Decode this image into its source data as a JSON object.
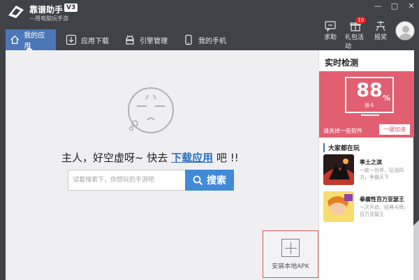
{
  "app": {
    "brand_name": "靠谱助手",
    "version": "V3",
    "tagline": "—用电脑玩手游"
  },
  "window_controls": {
    "minimize": "—",
    "maximize": "□",
    "close": "✕"
  },
  "tabs": [
    {
      "label": "我的应用",
      "icon": "home-icon",
      "active": true
    },
    {
      "label": "应用下载",
      "icon": "download-icon",
      "active": false
    },
    {
      "label": "引擎管理",
      "icon": "android-icon",
      "active": false
    },
    {
      "label": "我的手机",
      "icon": "phone-icon",
      "active": false
    }
  ],
  "actions": [
    {
      "label": "求助",
      "icon": "help-icon"
    },
    {
      "label": "礼包活动",
      "icon": "gift-icon",
      "badge": "10"
    },
    {
      "label": "摇奖",
      "icon": "lottery-icon"
    }
  ],
  "main": {
    "empty_prefix": "主人，好空虚呀~ 快去",
    "empty_link": "下载应用",
    "empty_suffix": "吧 !!",
    "search_placeholder": "试着搜索下，你想玩的手游吧",
    "search_button": "搜索",
    "install_apk": "安装本地APK"
  },
  "monitor": {
    "title": "实时检测",
    "value": "88",
    "unit": "%",
    "status": "很卡",
    "hint": "请关掉一些软件",
    "button": "一键加速"
  },
  "games_section": {
    "title": "大家都在玩",
    "games": [
      {
        "name": "率土之滨",
        "desc": "一款一世界，征战四方，争霸天下"
      },
      {
        "name": "拳腐性百万亚瑟王",
        "desc": "一次开启，经典卡牌，百万亚瑟王"
      }
    ]
  },
  "colors": {
    "titlebar": "#3f4247",
    "tab_active": "#4b77b6",
    "search_button": "#4289d7",
    "monitor_bg": "#e25f71",
    "link": "#2b6fc2"
  }
}
